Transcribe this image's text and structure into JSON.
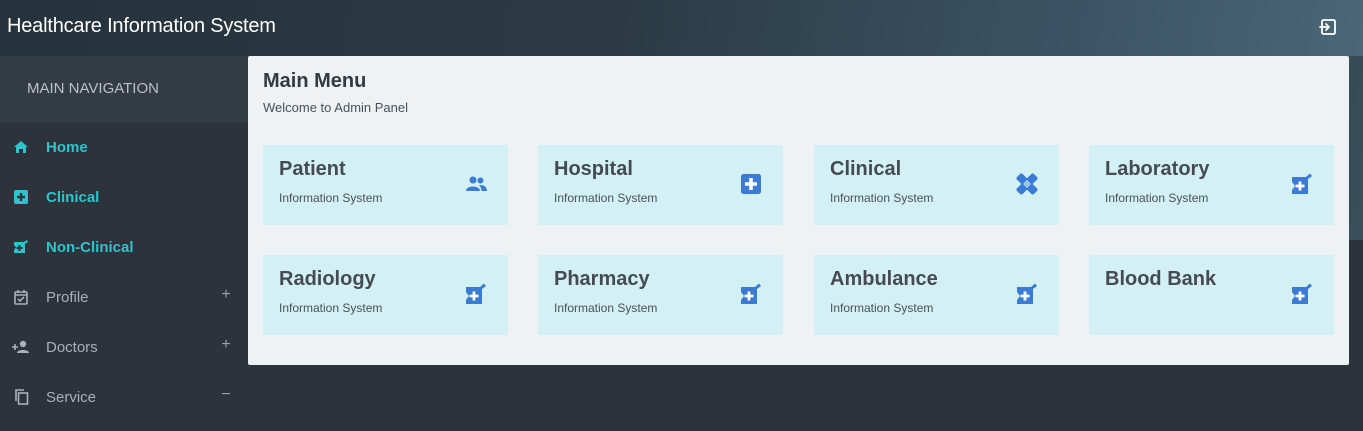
{
  "app": {
    "title": "Healthcare Information System"
  },
  "topbar": {
    "logout_icon": "logout-icon"
  },
  "sidebar": {
    "header": "MAIN NAVIGATION",
    "items": [
      {
        "label": "Home",
        "icon": "home-icon",
        "active": true
      },
      {
        "label": "Clinical",
        "icon": "medical-plus-icon",
        "active": true
      },
      {
        "label": "Non-Clinical",
        "icon": "pharmacy-icon",
        "active": true
      },
      {
        "label": "Profile",
        "icon": "calendar-check-icon",
        "toggle": "+"
      },
      {
        "label": "Doctors",
        "icon": "add-person-icon",
        "toggle": "+"
      },
      {
        "label": "Service",
        "icon": "copy-icon",
        "toggle": "−"
      }
    ]
  },
  "main": {
    "title": "Main Menu",
    "subtitle": "Welcome to Admin Panel",
    "cards": [
      {
        "title": "Patient",
        "subtitle": "Information System",
        "icon": "people-icon"
      },
      {
        "title": "Hospital",
        "subtitle": "Information System",
        "icon": "hospital-plus-icon"
      },
      {
        "title": "Clinical",
        "subtitle": "Information System",
        "icon": "bandage-icon"
      },
      {
        "title": "Laboratory",
        "subtitle": "Information System",
        "icon": "pharmacy-icon"
      },
      {
        "title": "Radiology",
        "subtitle": "Information System",
        "icon": "pharmacy-icon"
      },
      {
        "title": "Pharmacy",
        "subtitle": "Information System",
        "icon": "pharmacy-icon"
      },
      {
        "title": "Ambulance",
        "subtitle": "Information System",
        "icon": "pharmacy-icon"
      },
      {
        "title": "Blood Bank",
        "subtitle": "",
        "icon": "pharmacy-icon"
      }
    ]
  },
  "colors": {
    "accent": "#2fc3cc",
    "card_bg": "#d3f1f4",
    "icon_blue": "#3a7bd5",
    "panel_bg": "#eef2f5",
    "sidebar_bg": "#2c333a"
  }
}
